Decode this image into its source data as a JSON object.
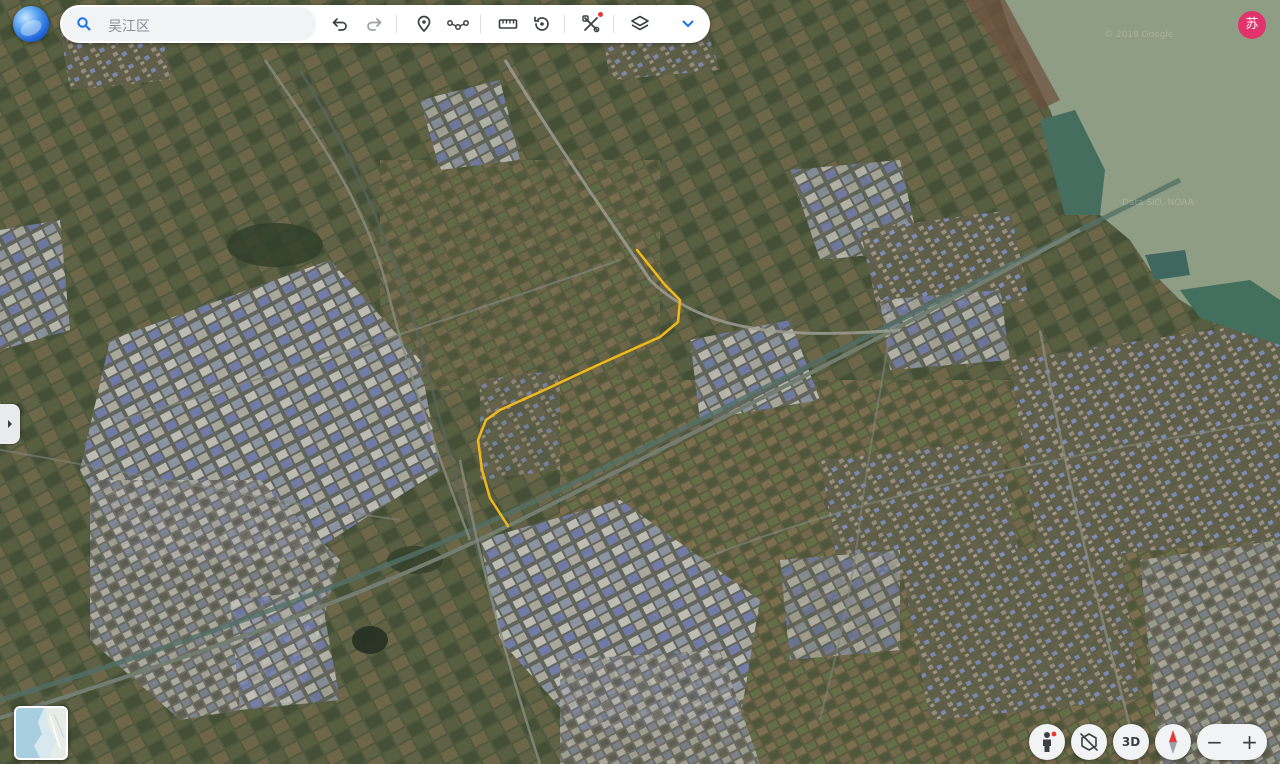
{
  "app": {
    "search": {
      "value": "吴江区"
    },
    "avatar": {
      "initial": "苏",
      "color": "#e2336b"
    },
    "watermarks": [
      "© 2018 Google",
      "Data SIO, NOAA"
    ],
    "controls": {
      "three_d_label": "3D",
      "zoom_out_label": "−",
      "zoom_in_label": "+"
    },
    "route": {
      "color": "#f2b81a"
    },
    "toolbar_icons": [
      "undo-icon",
      "redo-icon",
      "placemark-icon",
      "path-icon",
      "ruler-icon",
      "history-icon",
      "tools-icon",
      "layers-icon",
      "chevron-down-icon"
    ],
    "colors": {
      "water": "#8c9a80",
      "fields": "#4a5236"
    }
  }
}
